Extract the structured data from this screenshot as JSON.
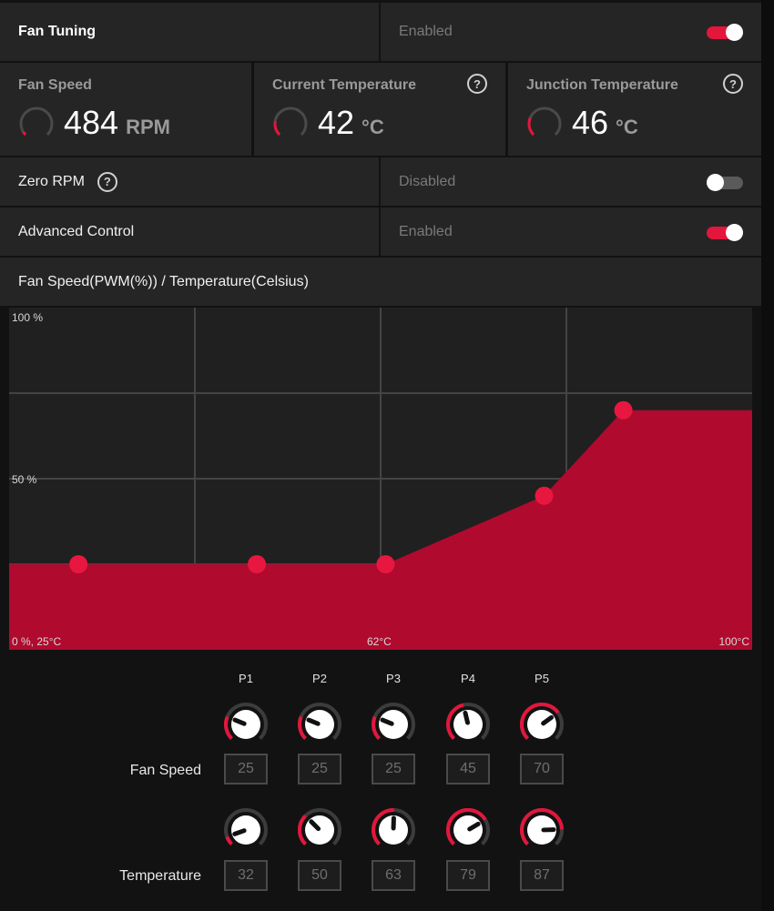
{
  "fan_tuning": {
    "title": "Fan Tuning",
    "status": "Enabled",
    "enabled": true
  },
  "metrics": [
    {
      "title": "Fan Speed",
      "value": "484",
      "unit": "RPM",
      "level": 0.05,
      "has_help": false
    },
    {
      "title": "Current Temperature",
      "value": "42",
      "unit": "°C",
      "level": 0.2,
      "has_help": true
    },
    {
      "title": "Junction Temperature",
      "value": "46",
      "unit": "°C",
      "level": 0.25,
      "has_help": true
    }
  ],
  "zero_rpm": {
    "label": "Zero RPM",
    "status": "Disabled",
    "enabled": false
  },
  "advanced_control": {
    "label": "Advanced Control",
    "status": "Enabled",
    "enabled": true
  },
  "curve_header": "Fan Speed(PWM(%)) / Temperature(Celsius)",
  "chart_labels": {
    "y_top": "100 %",
    "y_mid": "50 %",
    "origin": "0 %, 25°C",
    "x_mid": "62°C",
    "x_max": "100°C"
  },
  "chart_data": {
    "type": "area",
    "xlim": [
      25,
      100
    ],
    "ylim": [
      0,
      100
    ],
    "points": [
      {
        "name": "P1",
        "temperature": 32,
        "fan_speed": 25
      },
      {
        "name": "P2",
        "temperature": 50,
        "fan_speed": 25
      },
      {
        "name": "P3",
        "temperature": 63,
        "fan_speed": 25
      },
      {
        "name": "P4",
        "temperature": 79,
        "fan_speed": 45
      },
      {
        "name": "P5",
        "temperature": 87,
        "fan_speed": 70
      }
    ],
    "colors": {
      "fill": "#b00a2e",
      "point": "#e8173f",
      "grid": "#444444"
    }
  },
  "knobs": {
    "columns": [
      "P1",
      "P2",
      "P3",
      "P4",
      "P5"
    ],
    "fan_speed_label": "Fan Speed",
    "temperature_label": "Temperature",
    "fan_speed": [
      "25",
      "25",
      "25",
      "45",
      "70"
    ],
    "temperature": [
      "32",
      "50",
      "63",
      "79",
      "87"
    ]
  },
  "colors": {
    "accent": "#e3163c",
    "panel": "#252525",
    "background": "#121212"
  }
}
